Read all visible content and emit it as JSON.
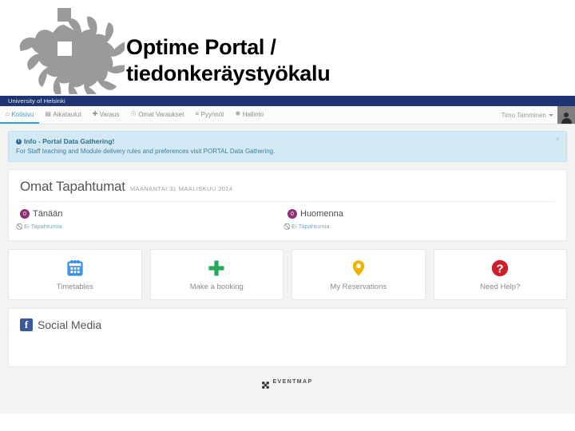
{
  "slide": {
    "title": "Optime Portal / tiedonkeräystyökalu",
    "logo_name": "university-of-helsinki-flame-logo"
  },
  "brandbar": {
    "organisation": "University of Helsinki"
  },
  "navbar": {
    "items": [
      {
        "label": "Kotisivu",
        "icon": "home-icon",
        "glyph": "⌂",
        "active": true
      },
      {
        "label": "Aikataulut",
        "icon": "book-icon",
        "glyph": "▤",
        "active": false
      },
      {
        "label": "Varaus",
        "icon": "plus-icon",
        "glyph": "✚",
        "active": false
      },
      {
        "label": "Omat Varaukset",
        "icon": "map-pin-icon",
        "glyph": "⚉",
        "active": false
      },
      {
        "label": "Pyynnöt",
        "icon": "list-icon",
        "glyph": "≡",
        "active": false
      },
      {
        "label": "Hallinto",
        "icon": "gear-icon",
        "glyph": "⚙",
        "active": false
      }
    ],
    "user_name": "Timo Tamminen"
  },
  "alert": {
    "title": "Info - Portal Data Gathering!",
    "body": "For Staff teaching and Module delivery rules and preferences visit PORTAL Data Gathering.",
    "close_label": "×",
    "info_glyph": "i",
    "bg_color": "#d3e9f3",
    "text_color": "#2a6f8e"
  },
  "events": {
    "title": "Omat Tapahtumat",
    "date": "MAANANTAI 31 MAALISKUU 2014",
    "badge_color": "#8e2f72",
    "columns": [
      {
        "badge": "0",
        "label": "Tänään",
        "empty_text": "Ei Tapahtumia"
      },
      {
        "badge": "0",
        "label": "Huomenna",
        "empty_text": "Ei Tapahtumia"
      }
    ]
  },
  "tiles": [
    {
      "label": "Timetables",
      "icon": "calendar-icon",
      "color": "#3e8ede"
    },
    {
      "label": "Make a booking",
      "icon": "plus-icon",
      "color": "#24a85b"
    },
    {
      "label": "My Reservations",
      "icon": "map-pin-icon",
      "color": "#f0b400"
    },
    {
      "label": "Need Help?",
      "icon": "question-circle-icon",
      "color": "#cc2128"
    }
  ],
  "social": {
    "label": "Social Media",
    "facebook_glyph": "f",
    "facebook_color": "#3b5998"
  },
  "footer": {
    "brand": "EVENTMAP",
    "mark": "eventmap-logo-icon"
  }
}
